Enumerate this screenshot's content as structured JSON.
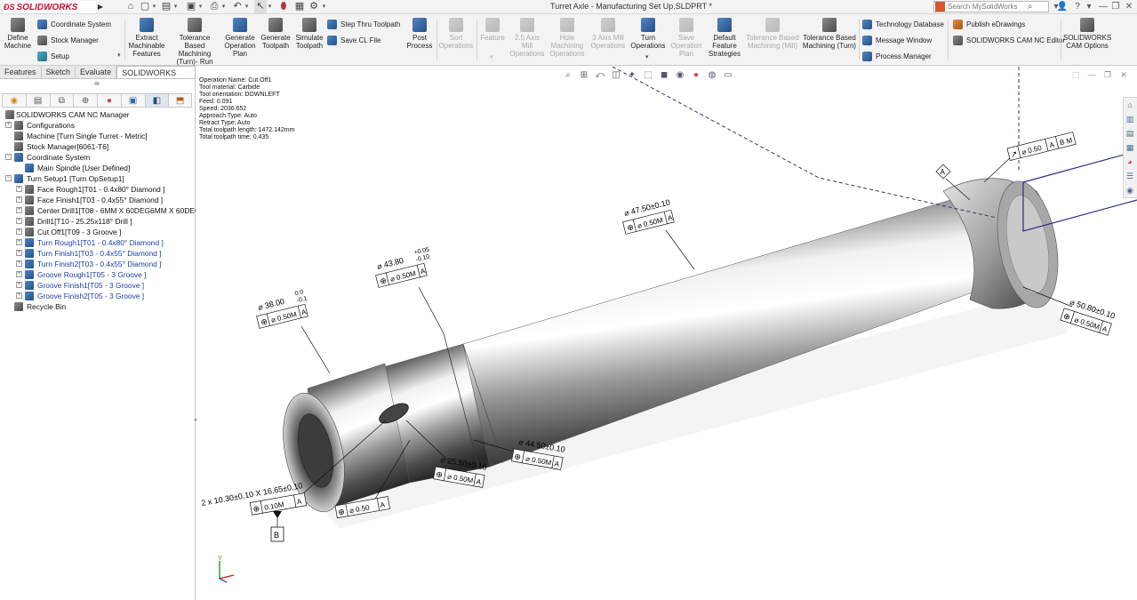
{
  "app": {
    "logo_text": "SOLIDWORKS",
    "window_title": "Turret Axle - Manufacturing Set Up.SLDPRT *",
    "search_placeholder": "Search MySolidWorks"
  },
  "ribbon": {
    "define_machine": "Define Machine",
    "coordinate_system": "Coordinate System",
    "stock_manager": "Stock Manager",
    "setup": "Setup",
    "extract_features": "Extract Machinable Features",
    "tolerance_run": "Tolerance Based Machining (Turn)- Run",
    "generate_plan": "Generate Operation Plan",
    "generate_toolpath": "Generate Toolpath",
    "simulate_toolpath": "Simulate Toolpath",
    "step_thru": "Step Thru Toolpath",
    "save_cl": "Save CL File",
    "post_process": "Post Process",
    "sort_operations": "Sort Operations",
    "feature": "Feature",
    "axis25_mill": "2.5 Axis Mill Operations",
    "hole_machining": "Hole Machining Operations",
    "axis3_mill": "3 Axis Mill Operations",
    "turn_operations": "Turn Operations",
    "save_plan": "Save Operation Plan",
    "default_strategies": "Default Feature Strategies",
    "tolerance_mill": "Tolerance Based Machining (Mill)",
    "tolerance_turn": "Tolerance Based Machining (Turn)",
    "technology_database": "Technology Database",
    "message_window": "Message Window",
    "process_manager": "Process Manager",
    "publish_edrawings": "Publish eDrawings",
    "nc_editor": "SOLIDWORKS CAM NC Editor",
    "cam_options": "SOLIDWORKS CAM Options"
  },
  "cm_tabs": [
    "Features",
    "Sketch",
    "Evaluate",
    "SOLIDWORKS CAM"
  ],
  "tree": {
    "root": "SOLIDWORKS CAM NC Manager",
    "configurations": "Configurations",
    "machine": "Machine [Turn Single Turret - Metric]",
    "stock": "Stock Manager[6061-T6]",
    "coord_system": "Coordinate System",
    "main_spindle": "Main Spindle [User Defined]",
    "turn_setup": "Turn Setup1 [Turn OpSetup1]",
    "ops": [
      {
        "label": "Face Rough1[T01 - 0.4x80° Diamond ]",
        "blue": false
      },
      {
        "label": "Face Finish1[T03 - 0.4x55° Diamond ]",
        "blue": false
      },
      {
        "label": "Center Drill1[T08 - 6MM X 60DEG6MM X 60DEG CE",
        "blue": false
      },
      {
        "label": "Drill1[T10 - 25.25x118° Drill ]",
        "blue": false
      },
      {
        "label": "Cut Off1[T09 - 3 Groove ]",
        "blue": false
      },
      {
        "label": "Turn Rough1[T01 - 0.4x80° Diamond ]",
        "blue": true
      },
      {
        "label": "Turn Finish1[T03 - 0.4x55° Diamond ]",
        "blue": true
      },
      {
        "label": "Turn Finish2[T03 - 0.4x55° Diamond ]",
        "blue": true
      },
      {
        "label": "Groove Rough1[T05 - 3 Groove ]",
        "blue": true
      },
      {
        "label": "Groove Finish1[T05 - 3 Groove ]",
        "blue": true
      },
      {
        "label": "Groove Finish2[T05 - 3 Groove ]",
        "blue": true
      }
    ],
    "recycle_bin": "Recycle Bin"
  },
  "op_info": [
    "Operation Name: Cut Off1",
    "Tool material: Carbide",
    "Tool orientation: DOWNLEFT",
    "Feed: 0.091",
    "Speed: 2036.652",
    "Approach Type: Auto",
    "Retract Type: Auto",
    "Total toolpath length: 1472.142mm",
    "Total toolpath time: 0.435"
  ],
  "annotations": {
    "d38": "38.00",
    "d38_tol_up": "0.0",
    "d38_tol_dn": "-0.1",
    "fcf_38": "0.50M",
    "d43": "43.80",
    "d43_tol_up": "+0.05",
    "d43_tol_dn": "-0.10",
    "fcf_43": "0.50M",
    "d47": "47.50±0.10",
    "fcf_47": "0.50M",
    "fcf_top": "0.50",
    "fcf_top_ref": "A",
    "fcf_top_ref2": "B M",
    "d50": "50.80±0.10",
    "fcf_50": "0.50M",
    "d44": "44.50±0.10",
    "fcf_44": "0.50M",
    "d25": "25.50±0.10",
    "fcf_25": "0.50M",
    "d_small": "0.50",
    "slot": "2 x 10.30±0.10 X 16.65±0.10",
    "fcf_slot": "0.10M",
    "datum_a": "A",
    "datum_b": "B",
    "ref_a": "A"
  }
}
